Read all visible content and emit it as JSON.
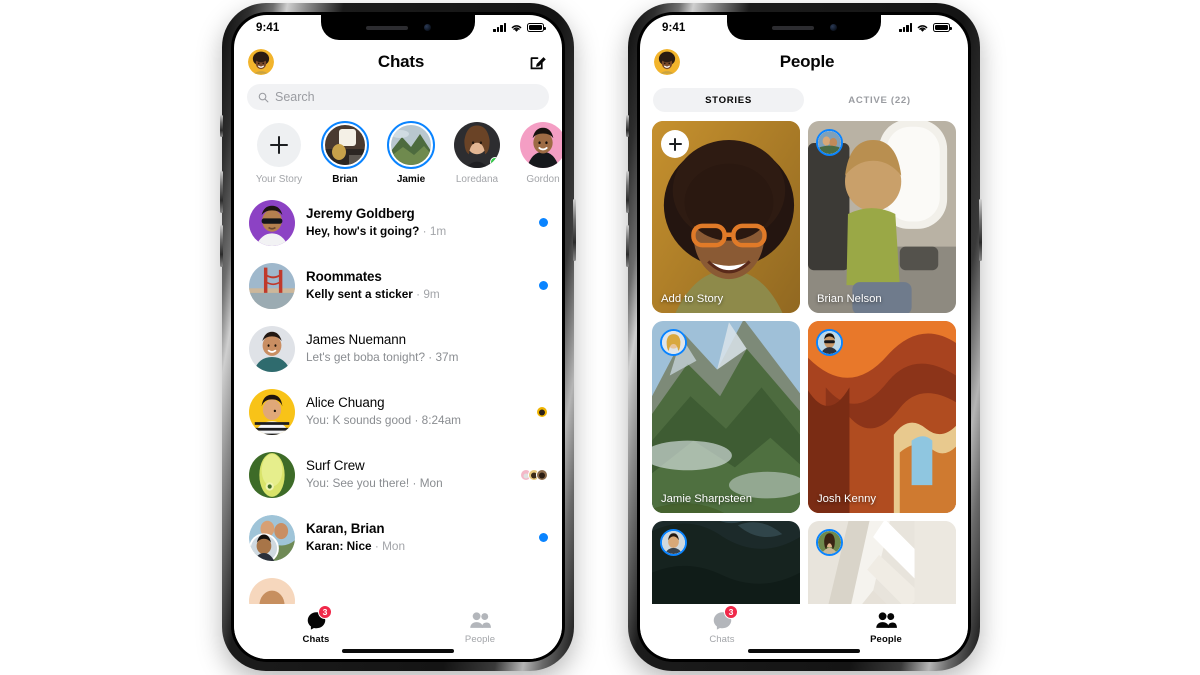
{
  "colors": {
    "accent_blue": "#0a84ff",
    "badge_red": "#f02849",
    "online_green": "#31cc46",
    "text_primary": "#050505",
    "text_secondary": "#8a8d91",
    "text_muted": "#a3a5a9",
    "field_bg": "#f1f2f4",
    "page_bg": "#ffffff"
  },
  "phone_left": {
    "status_bar": {
      "time": "9:41",
      "cellular_icon": "signal-bars-icon",
      "wifi_icon": "wifi-icon",
      "battery_icon": "battery-full-icon"
    },
    "header": {
      "profile_avatar": "user-avatar",
      "title": "Chats",
      "compose_icon": "compose-pencil-icon"
    },
    "search": {
      "icon": "search-icon",
      "placeholder": "Search",
      "value": ""
    },
    "stories": [
      {
        "label": "Your Story",
        "type": "add",
        "icon": "plus-icon",
        "ring": false,
        "online": false
      },
      {
        "label": "Brian",
        "type": "story",
        "ring": true,
        "online": false
      },
      {
        "label": "Jamie",
        "type": "story",
        "ring": true,
        "online": false
      },
      {
        "label": "Loredana",
        "type": "story",
        "ring": false,
        "online": true
      },
      {
        "label": "Gordon",
        "type": "story",
        "ring": false,
        "online": false
      }
    ],
    "chats": [
      {
        "name": "Jeremy Goldberg",
        "snippet": "Hey, how's it going?",
        "meta": "1m",
        "unread": true,
        "status": "unread-dot",
        "sender": ""
      },
      {
        "name": "Roommates",
        "snippet": "Kelly sent a sticker",
        "meta": "9m",
        "unread": true,
        "status": "unread-dot",
        "sender": ""
      },
      {
        "name": "James Nuemann",
        "snippet": "Let's get boba tonight?",
        "meta": "37m",
        "unread": false,
        "status": "none",
        "sender": ""
      },
      {
        "name": "Alice Chuang",
        "snippet": "You: K sounds good",
        "meta": "8:24am",
        "unread": false,
        "status": "seen-1",
        "sender": ""
      },
      {
        "name": "Surf Crew",
        "snippet": "You: See you there!",
        "meta": "Mon",
        "unread": false,
        "status": "seen-3",
        "sender": ""
      },
      {
        "name": "Karan, Brian",
        "snippet": "Nice",
        "meta": "Mon",
        "unread": true,
        "status": "unread-dot",
        "sender": "Karan:"
      }
    ],
    "tabs": [
      {
        "label": "Chats",
        "icon": "chat-bubble-icon",
        "active": true,
        "badge": "3"
      },
      {
        "label": "People",
        "icon": "people-icon",
        "active": false,
        "badge": ""
      }
    ]
  },
  "phone_right": {
    "status_bar": {
      "time": "9:41",
      "cellular_icon": "signal-bars-icon",
      "wifi_icon": "wifi-icon",
      "battery_icon": "battery-full-icon"
    },
    "header": {
      "profile_avatar": "user-avatar",
      "title": "People"
    },
    "segments": [
      {
        "label": "STORIES",
        "selected": true
      },
      {
        "label": "ACTIVE (22)",
        "selected": false
      }
    ],
    "tiles": [
      {
        "label": "Add to Story",
        "kind": "add",
        "icon": "plus-icon",
        "scene": "portrait-woman-glasses"
      },
      {
        "label": "Brian Nelson",
        "kind": "story",
        "scene": "child-airplane-window"
      },
      {
        "label": "Jamie Sharpsteen",
        "kind": "story",
        "scene": "green-mountain"
      },
      {
        "label": "Josh Kenny",
        "kind": "story",
        "scene": "slot-canyon"
      },
      {
        "label": "",
        "kind": "story",
        "scene": "dark-forest"
      },
      {
        "label": "",
        "kind": "story",
        "scene": "white-architecture"
      }
    ],
    "tabs": [
      {
        "label": "Chats",
        "icon": "chat-bubble-icon",
        "active": false,
        "badge": "3"
      },
      {
        "label": "People",
        "icon": "people-icon",
        "active": true,
        "badge": ""
      }
    ]
  }
}
